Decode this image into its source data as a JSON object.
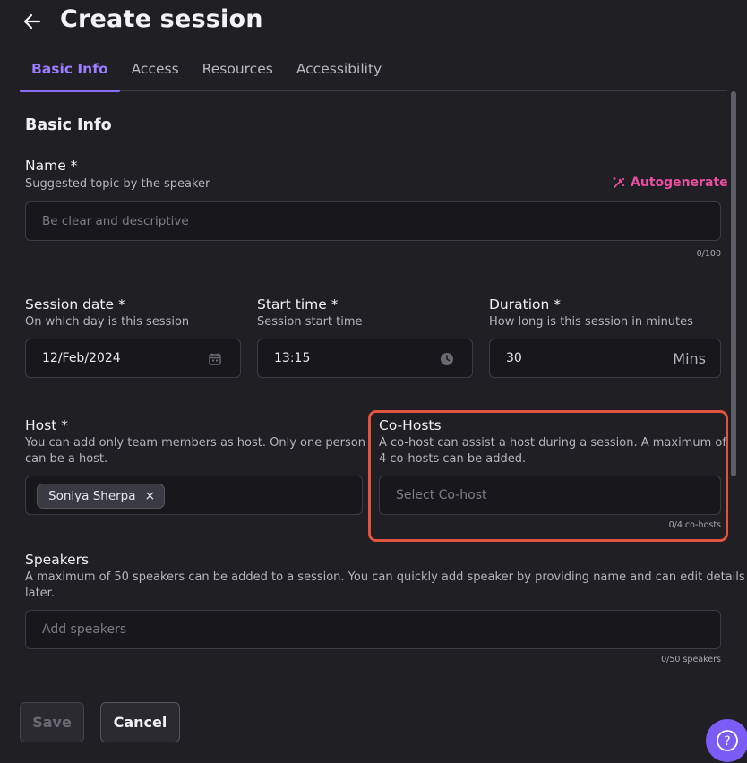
{
  "header": {
    "title": "Create session",
    "back_icon": "arrow-left-icon"
  },
  "tabs": [
    {
      "label": "Basic Info",
      "active": true
    },
    {
      "label": "Access",
      "active": false
    },
    {
      "label": "Resources",
      "active": false
    },
    {
      "label": "Accessibility",
      "active": false
    }
  ],
  "section": {
    "title": "Basic Info"
  },
  "name": {
    "label": "Name *",
    "sublabel": "Suggested topic by the speaker",
    "autogenerate": "Autogenerate",
    "placeholder": "Be clear and descriptive",
    "counter": "0/100"
  },
  "session_date": {
    "label": "Session date *",
    "sublabel": "On which day is this session",
    "value": "12/Feb/2024"
  },
  "start_time": {
    "label": "Start time *",
    "sublabel": "Session start time",
    "value": "13:15"
  },
  "duration": {
    "label": "Duration *",
    "sublabel": "How long is this session in minutes",
    "value": "30",
    "suffix": "Mins"
  },
  "host": {
    "label": "Host *",
    "sublabel_line1": "You can add only team members as host. Only one person",
    "sublabel_line2": "can be a host.",
    "chip": "Soniya Sherpa",
    "chip_remove": "×"
  },
  "cohosts": {
    "label": "Co-Hosts",
    "sublabel_line1": "A co-host can assist a host during a session. A maximum of",
    "sublabel_line2": "4 co-hosts can be added.",
    "placeholder": "Select Co-host",
    "counter": "0/4 co-hosts"
  },
  "speakers": {
    "label": "Speakers",
    "sublabel_line1": "A maximum of 50 speakers can be added to a session. You can quickly add speaker by providing name and can edit details",
    "sublabel_line2": "later.",
    "placeholder": "Add speakers",
    "counter": "0/50 speakers"
  },
  "actions": {
    "save": "Save",
    "cancel": "Cancel",
    "help": "?"
  },
  "colors": {
    "accent": "#8b6cf6",
    "autogenerate": "#ea4f9f",
    "highlight": "#e0533f",
    "background": "#1f1f24"
  }
}
